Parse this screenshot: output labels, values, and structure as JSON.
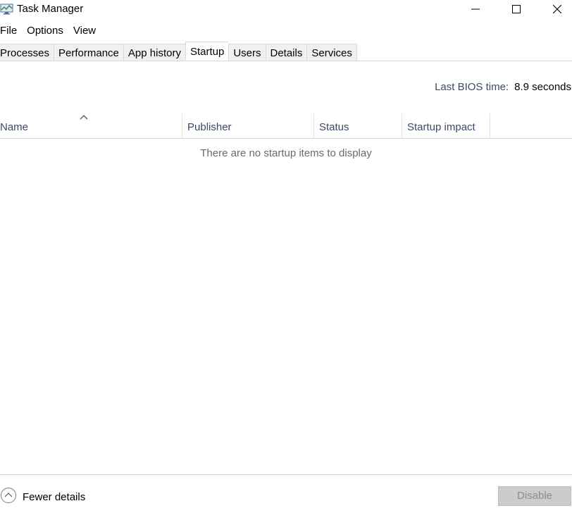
{
  "window": {
    "title": "Task Manager",
    "controls": {
      "minimize": "minimize-icon",
      "maximize": "maximize-icon",
      "close": "close-icon"
    }
  },
  "menu": {
    "items": [
      "File",
      "Options",
      "View"
    ]
  },
  "tabs": {
    "items": [
      "Processes",
      "Performance",
      "App history",
      "Startup",
      "Users",
      "Details",
      "Services"
    ],
    "active": "Startup"
  },
  "bios": {
    "label": "Last BIOS time:",
    "value": "8.9 seconds"
  },
  "table": {
    "columns": [
      "Name",
      "Publisher",
      "Status",
      "Startup impact"
    ],
    "sorted_column": "Name",
    "empty_message": "There are no startup items to display"
  },
  "footer": {
    "fewer_details_label": "Fewer details",
    "disable_label": "Disable",
    "disable_enabled": false
  },
  "colors": {
    "header_text": "#3a4a65",
    "tab_bg": "#f0f0f0",
    "disabled_button_bg": "#cccccc"
  }
}
